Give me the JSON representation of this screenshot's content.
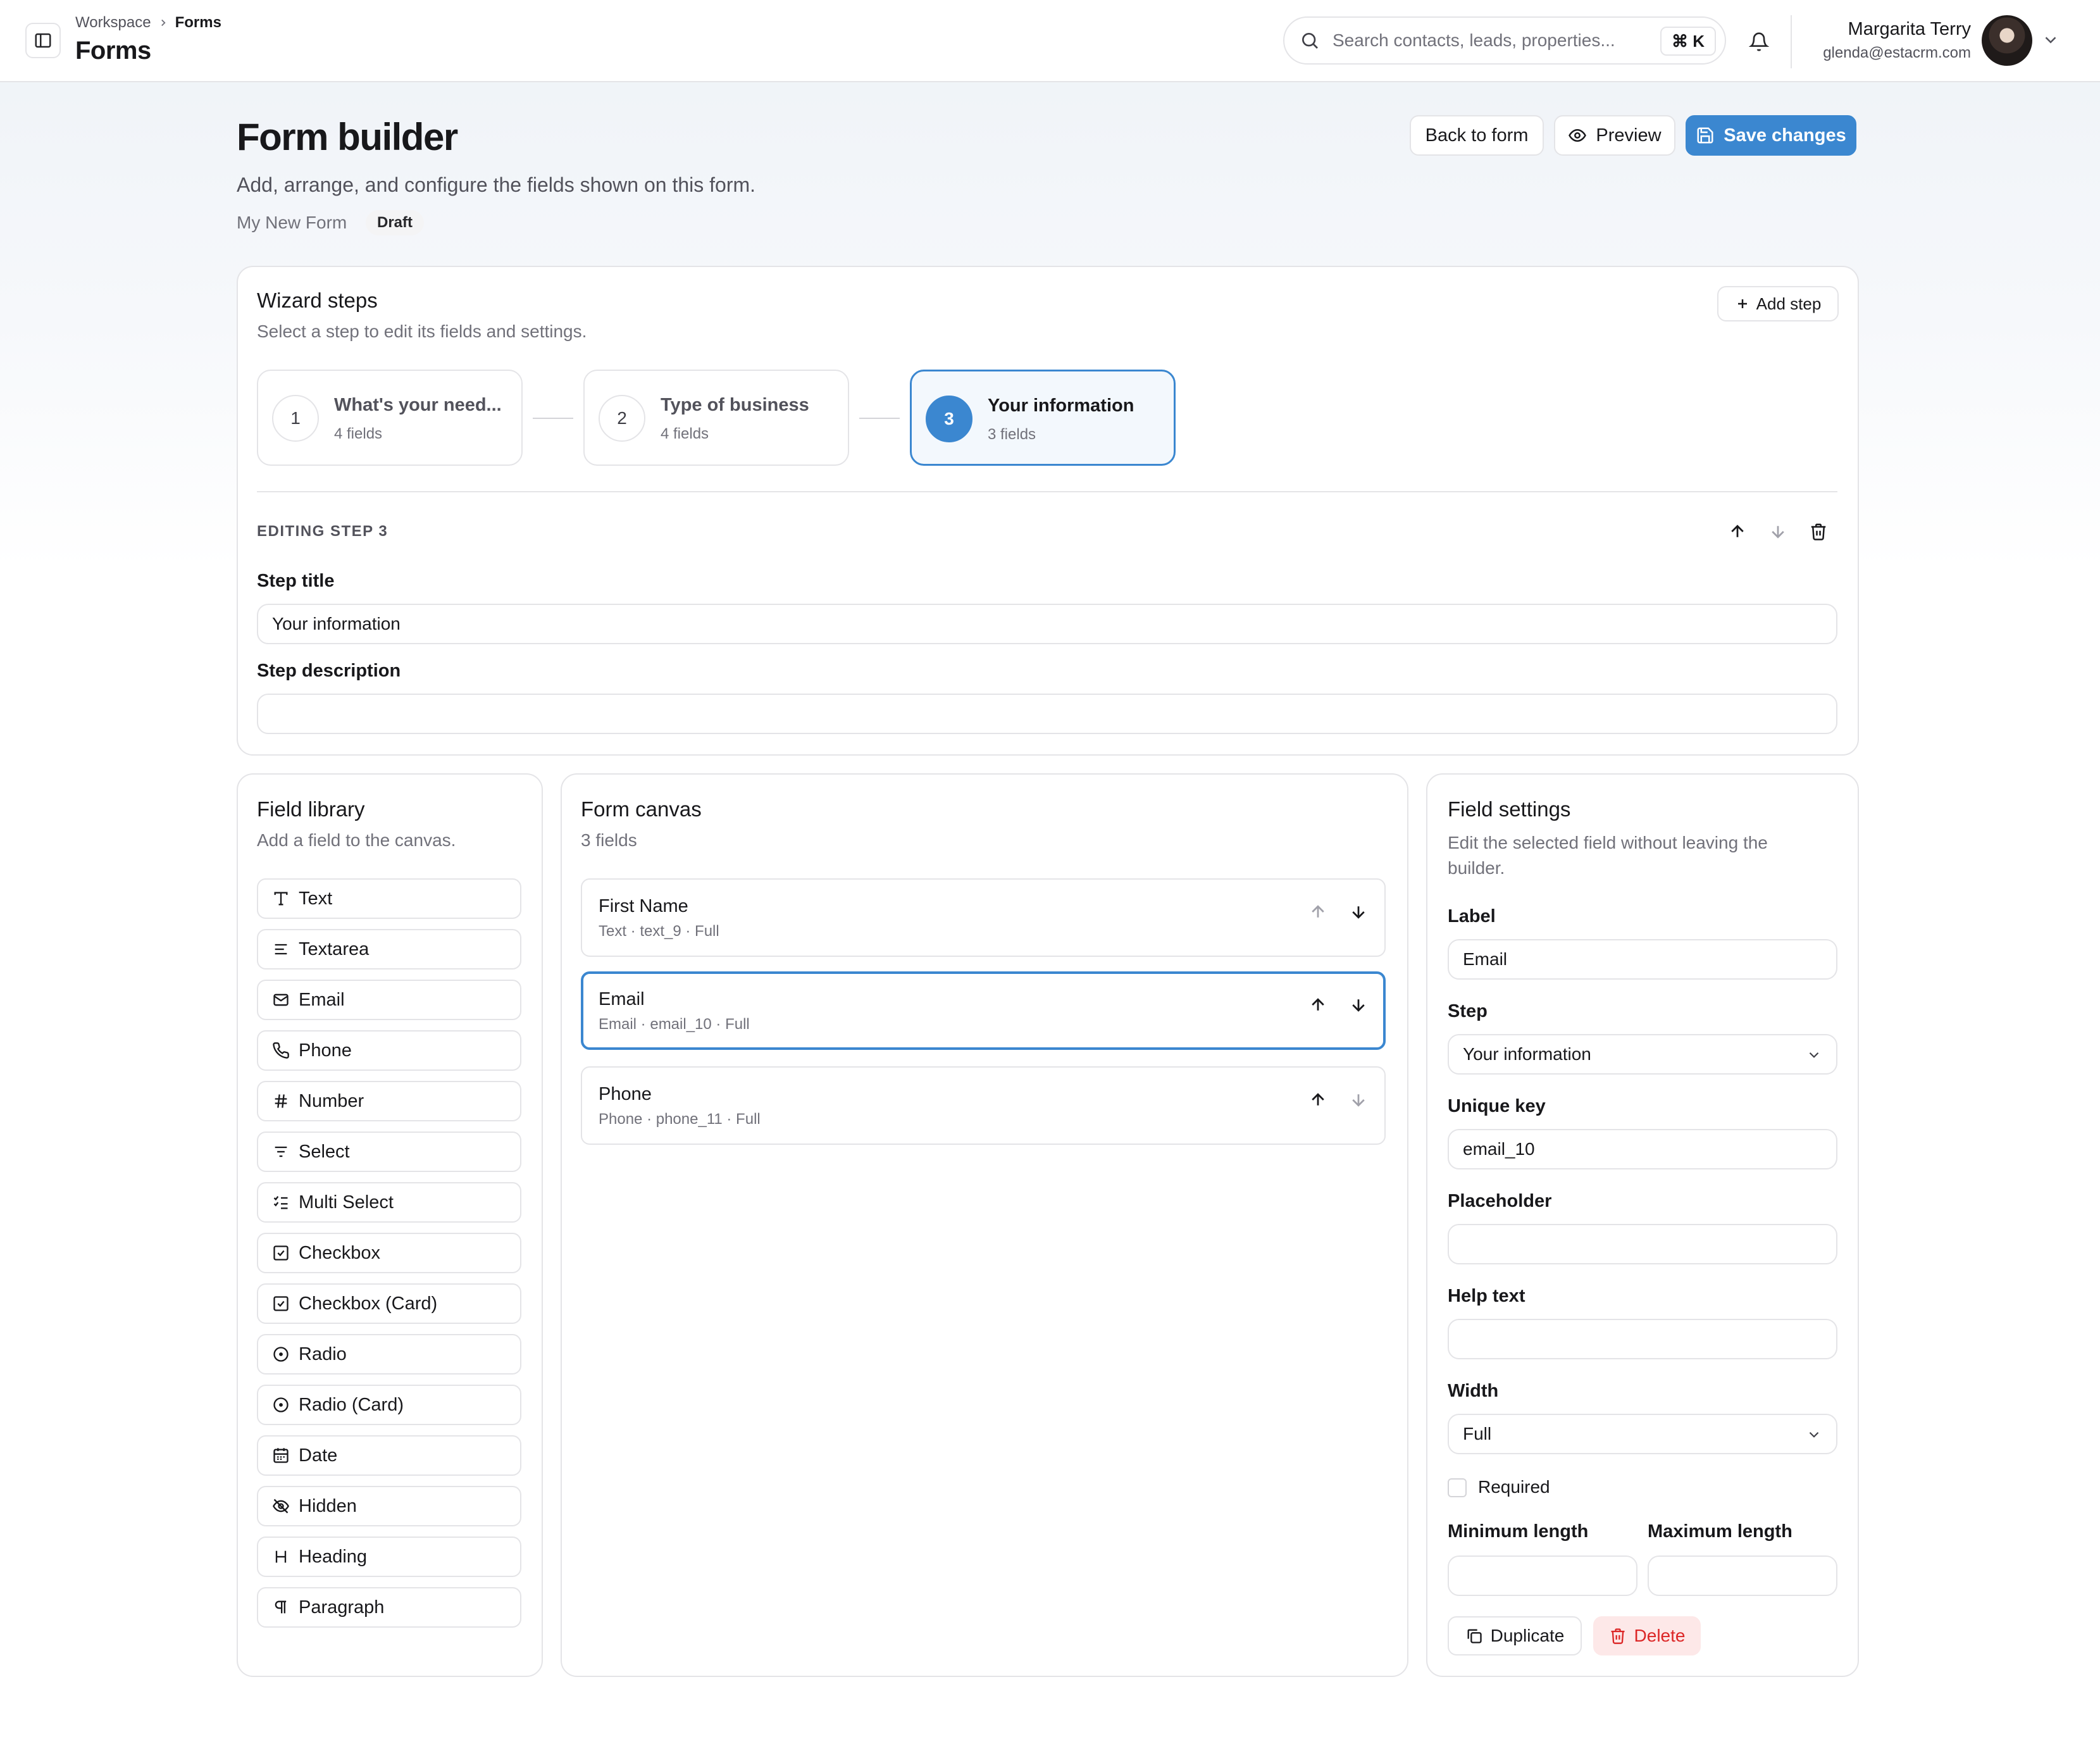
{
  "topbar": {
    "breadcrumb": [
      "Workspace",
      "Forms"
    ],
    "page_name": "Forms",
    "search_placeholder": "Search contacts, leads, properties...",
    "shortcut": "⌘ K",
    "user_name": "Margarita Terry",
    "user_email": "glenda@estacrm.com"
  },
  "header": {
    "title": "Form builder",
    "subtitle": "Add, arrange, and configure the fields shown on this form.",
    "form_name": "My New Form",
    "status": "Draft",
    "back_label": "Back to form",
    "preview_label": "Preview",
    "save_label": "Save changes"
  },
  "wizard": {
    "title": "Wizard steps",
    "subtitle": "Select a step to edit its fields and settings.",
    "add_step_label": "Add step",
    "steps": [
      {
        "number": "1",
        "title": "What's your need...",
        "count": "4 fields"
      },
      {
        "number": "2",
        "title": "Type of business",
        "count": "4 fields"
      },
      {
        "number": "3",
        "title": "Your information",
        "count": "3 fields",
        "active": true
      }
    ],
    "editing_label": "EDITING STEP 3",
    "step_title_label": "Step title",
    "step_title_value": "Your information",
    "step_description_label": "Step description",
    "step_description_value": ""
  },
  "library": {
    "title": "Field library",
    "subtitle": "Add a field to the canvas.",
    "items": [
      {
        "label": "Text",
        "icon": "text-icon"
      },
      {
        "label": "Textarea",
        "icon": "textarea-icon"
      },
      {
        "label": "Email",
        "icon": "mail-icon"
      },
      {
        "label": "Phone",
        "icon": "phone-icon"
      },
      {
        "label": "Number",
        "icon": "hash-icon"
      },
      {
        "label": "Select",
        "icon": "filter-icon"
      },
      {
        "label": "Multi Select",
        "icon": "list-checks-icon"
      },
      {
        "label": "Checkbox",
        "icon": "square-check-icon"
      },
      {
        "label": "Checkbox (Card)",
        "icon": "square-check-icon"
      },
      {
        "label": "Radio",
        "icon": "circle-dot-icon"
      },
      {
        "label": "Radio (Card)",
        "icon": "circle-dot-icon"
      },
      {
        "label": "Date",
        "icon": "calendar-icon"
      },
      {
        "label": "Hidden",
        "icon": "eye-off-icon"
      },
      {
        "label": "Heading",
        "icon": "heading-icon"
      },
      {
        "label": "Paragraph",
        "icon": "pilcrow-icon"
      }
    ]
  },
  "canvas": {
    "title": "Form canvas",
    "count": "3 fields",
    "fields": [
      {
        "title": "First Name",
        "meta": "Text · text_9 · Full"
      },
      {
        "title": "Email",
        "meta": "Email · email_10 · Full",
        "selected": true
      },
      {
        "title": "Phone",
        "meta": "Phone · phone_11 · Full"
      }
    ]
  },
  "settings": {
    "title": "Field settings",
    "subtitle": "Edit the selected field without leaving the builder.",
    "label_label": "Label",
    "label_value": "Email",
    "step_label": "Step",
    "step_value": "Your information",
    "key_label": "Unique key",
    "key_value": "email_10",
    "placeholder_label": "Placeholder",
    "placeholder_value": "",
    "help_label": "Help text",
    "help_value": "",
    "width_label": "Width",
    "width_value": "Full",
    "required_label": "Required",
    "required_checked": false,
    "min_label": "Minimum length",
    "max_label": "Maximum length",
    "min_value": "",
    "max_value": "",
    "duplicate_label": "Duplicate",
    "delete_label": "Delete"
  },
  "colors": {
    "accent": "#3b87d0",
    "danger": "#dc2626",
    "border": "#e4e4e7"
  }
}
